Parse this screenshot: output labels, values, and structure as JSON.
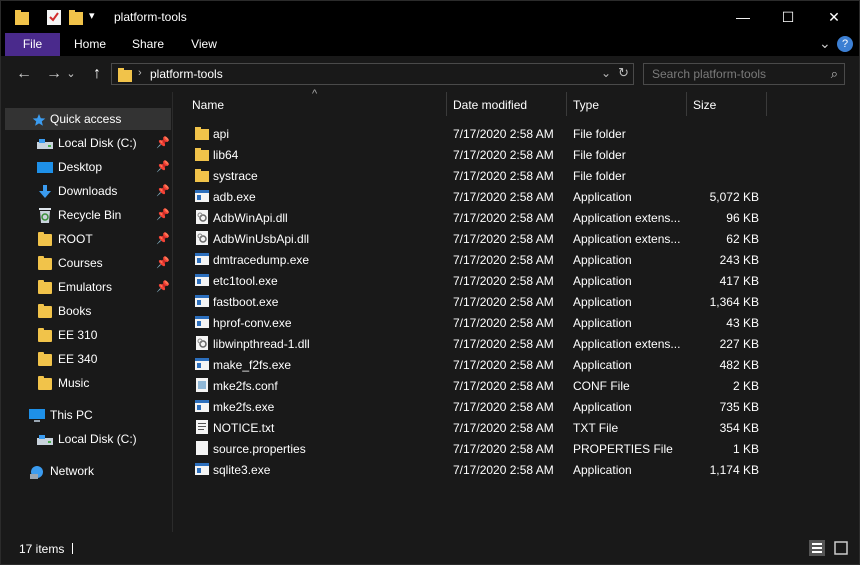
{
  "window": {
    "title": "platform-tools",
    "minimize_glyph": "—",
    "maximize_glyph": "☐",
    "close_glyph": "✕",
    "quick_access_dropdown_glyph": "▾"
  },
  "ribbon": {
    "tabs": [
      "File",
      "Home",
      "Share",
      "View"
    ],
    "expand_glyph": "⌄",
    "help_glyph": "?",
    "accent_color": "#4a2a8c"
  },
  "address": {
    "back_glyph": "←",
    "forward_glyph": "→",
    "recent_glyph": "⌄",
    "up_glyph": "↑",
    "path": "platform-tools",
    "dropdown_glyph": "⌄",
    "refresh_glyph": "↻"
  },
  "search": {
    "placeholder": "Search platform-tools",
    "icon_glyph": "⌕"
  },
  "nav": {
    "pin_glyph": "📌",
    "items": [
      {
        "label": "Quick access",
        "icon": "star-icon",
        "pinned": false
      },
      {
        "label": "Local Disk (C:)",
        "icon": "drive-icon",
        "pinned": true
      },
      {
        "label": "Desktop",
        "icon": "desktop-icon",
        "pinned": true
      },
      {
        "label": "Downloads",
        "icon": "download-icon",
        "pinned": true
      },
      {
        "label": "Recycle Bin",
        "icon": "recycle-bin-icon",
        "pinned": true
      },
      {
        "label": "ROOT",
        "icon": "folder-icon",
        "pinned": true
      },
      {
        "label": "Courses",
        "icon": "folder-icon",
        "pinned": true
      },
      {
        "label": "Emulators",
        "icon": "folder-icon",
        "pinned": true
      },
      {
        "label": "Books",
        "icon": "folder-icon",
        "pinned": false
      },
      {
        "label": "EE 310",
        "icon": "folder-icon",
        "pinned": false
      },
      {
        "label": "EE 340",
        "icon": "folder-icon",
        "pinned": false
      },
      {
        "label": "Music",
        "icon": "folder-icon",
        "pinned": false
      },
      {
        "label": "This PC",
        "icon": "computer-icon",
        "pinned": false
      },
      {
        "label": "Local Disk (C:)",
        "icon": "drive-icon",
        "pinned": false
      },
      {
        "label": "Network",
        "icon": "network-icon",
        "pinned": false
      }
    ]
  },
  "columns": {
    "name": "Name",
    "date": "Date modified",
    "type": "Type",
    "size": "Size",
    "sort_glyph": "^"
  },
  "files": [
    {
      "name": "api",
      "date": "7/17/2020 2:58 AM",
      "type": "File folder",
      "size": "",
      "icon": "folder-icon"
    },
    {
      "name": "lib64",
      "date": "7/17/2020 2:58 AM",
      "type": "File folder",
      "size": "",
      "icon": "folder-icon"
    },
    {
      "name": "systrace",
      "date": "7/17/2020 2:58 AM",
      "type": "File folder",
      "size": "",
      "icon": "folder-icon"
    },
    {
      "name": "adb.exe",
      "date": "7/17/2020 2:58 AM",
      "type": "Application",
      "size": "5,072 KB",
      "icon": "application-icon"
    },
    {
      "name": "AdbWinApi.dll",
      "date": "7/17/2020 2:58 AM",
      "type": "Application extens...",
      "size": "96 KB",
      "icon": "dll-icon"
    },
    {
      "name": "AdbWinUsbApi.dll",
      "date": "7/17/2020 2:58 AM",
      "type": "Application extens...",
      "size": "62 KB",
      "icon": "dll-icon"
    },
    {
      "name": "dmtracedump.exe",
      "date": "7/17/2020 2:58 AM",
      "type": "Application",
      "size": "243 KB",
      "icon": "application-icon"
    },
    {
      "name": "etc1tool.exe",
      "date": "7/17/2020 2:58 AM",
      "type": "Application",
      "size": "417 KB",
      "icon": "application-icon"
    },
    {
      "name": "fastboot.exe",
      "date": "7/17/2020 2:58 AM",
      "type": "Application",
      "size": "1,364 KB",
      "icon": "application-icon"
    },
    {
      "name": "hprof-conv.exe",
      "date": "7/17/2020 2:58 AM",
      "type": "Application",
      "size": "43 KB",
      "icon": "application-icon"
    },
    {
      "name": "libwinpthread-1.dll",
      "date": "7/17/2020 2:58 AM",
      "type": "Application extens...",
      "size": "227 KB",
      "icon": "dll-icon"
    },
    {
      "name": "make_f2fs.exe",
      "date": "7/17/2020 2:58 AM",
      "type": "Application",
      "size": "482 KB",
      "icon": "application-icon"
    },
    {
      "name": "mke2fs.conf",
      "date": "7/17/2020 2:58 AM",
      "type": "CONF File",
      "size": "2 KB",
      "icon": "conf-file-icon"
    },
    {
      "name": "mke2fs.exe",
      "date": "7/17/2020 2:58 AM",
      "type": "Application",
      "size": "735 KB",
      "icon": "application-icon"
    },
    {
      "name": "NOTICE.txt",
      "date": "7/17/2020 2:58 AM",
      "type": "TXT File",
      "size": "354 KB",
      "icon": "text-file-icon"
    },
    {
      "name": "source.properties",
      "date": "7/17/2020 2:58 AM",
      "type": "PROPERTIES File",
      "size": "1 KB",
      "icon": "blank-file-icon"
    },
    {
      "name": "sqlite3.exe",
      "date": "7/17/2020 2:58 AM",
      "type": "Application",
      "size": "1,174 KB",
      "icon": "application-icon"
    }
  ],
  "status": {
    "item_count": "17 items"
  }
}
